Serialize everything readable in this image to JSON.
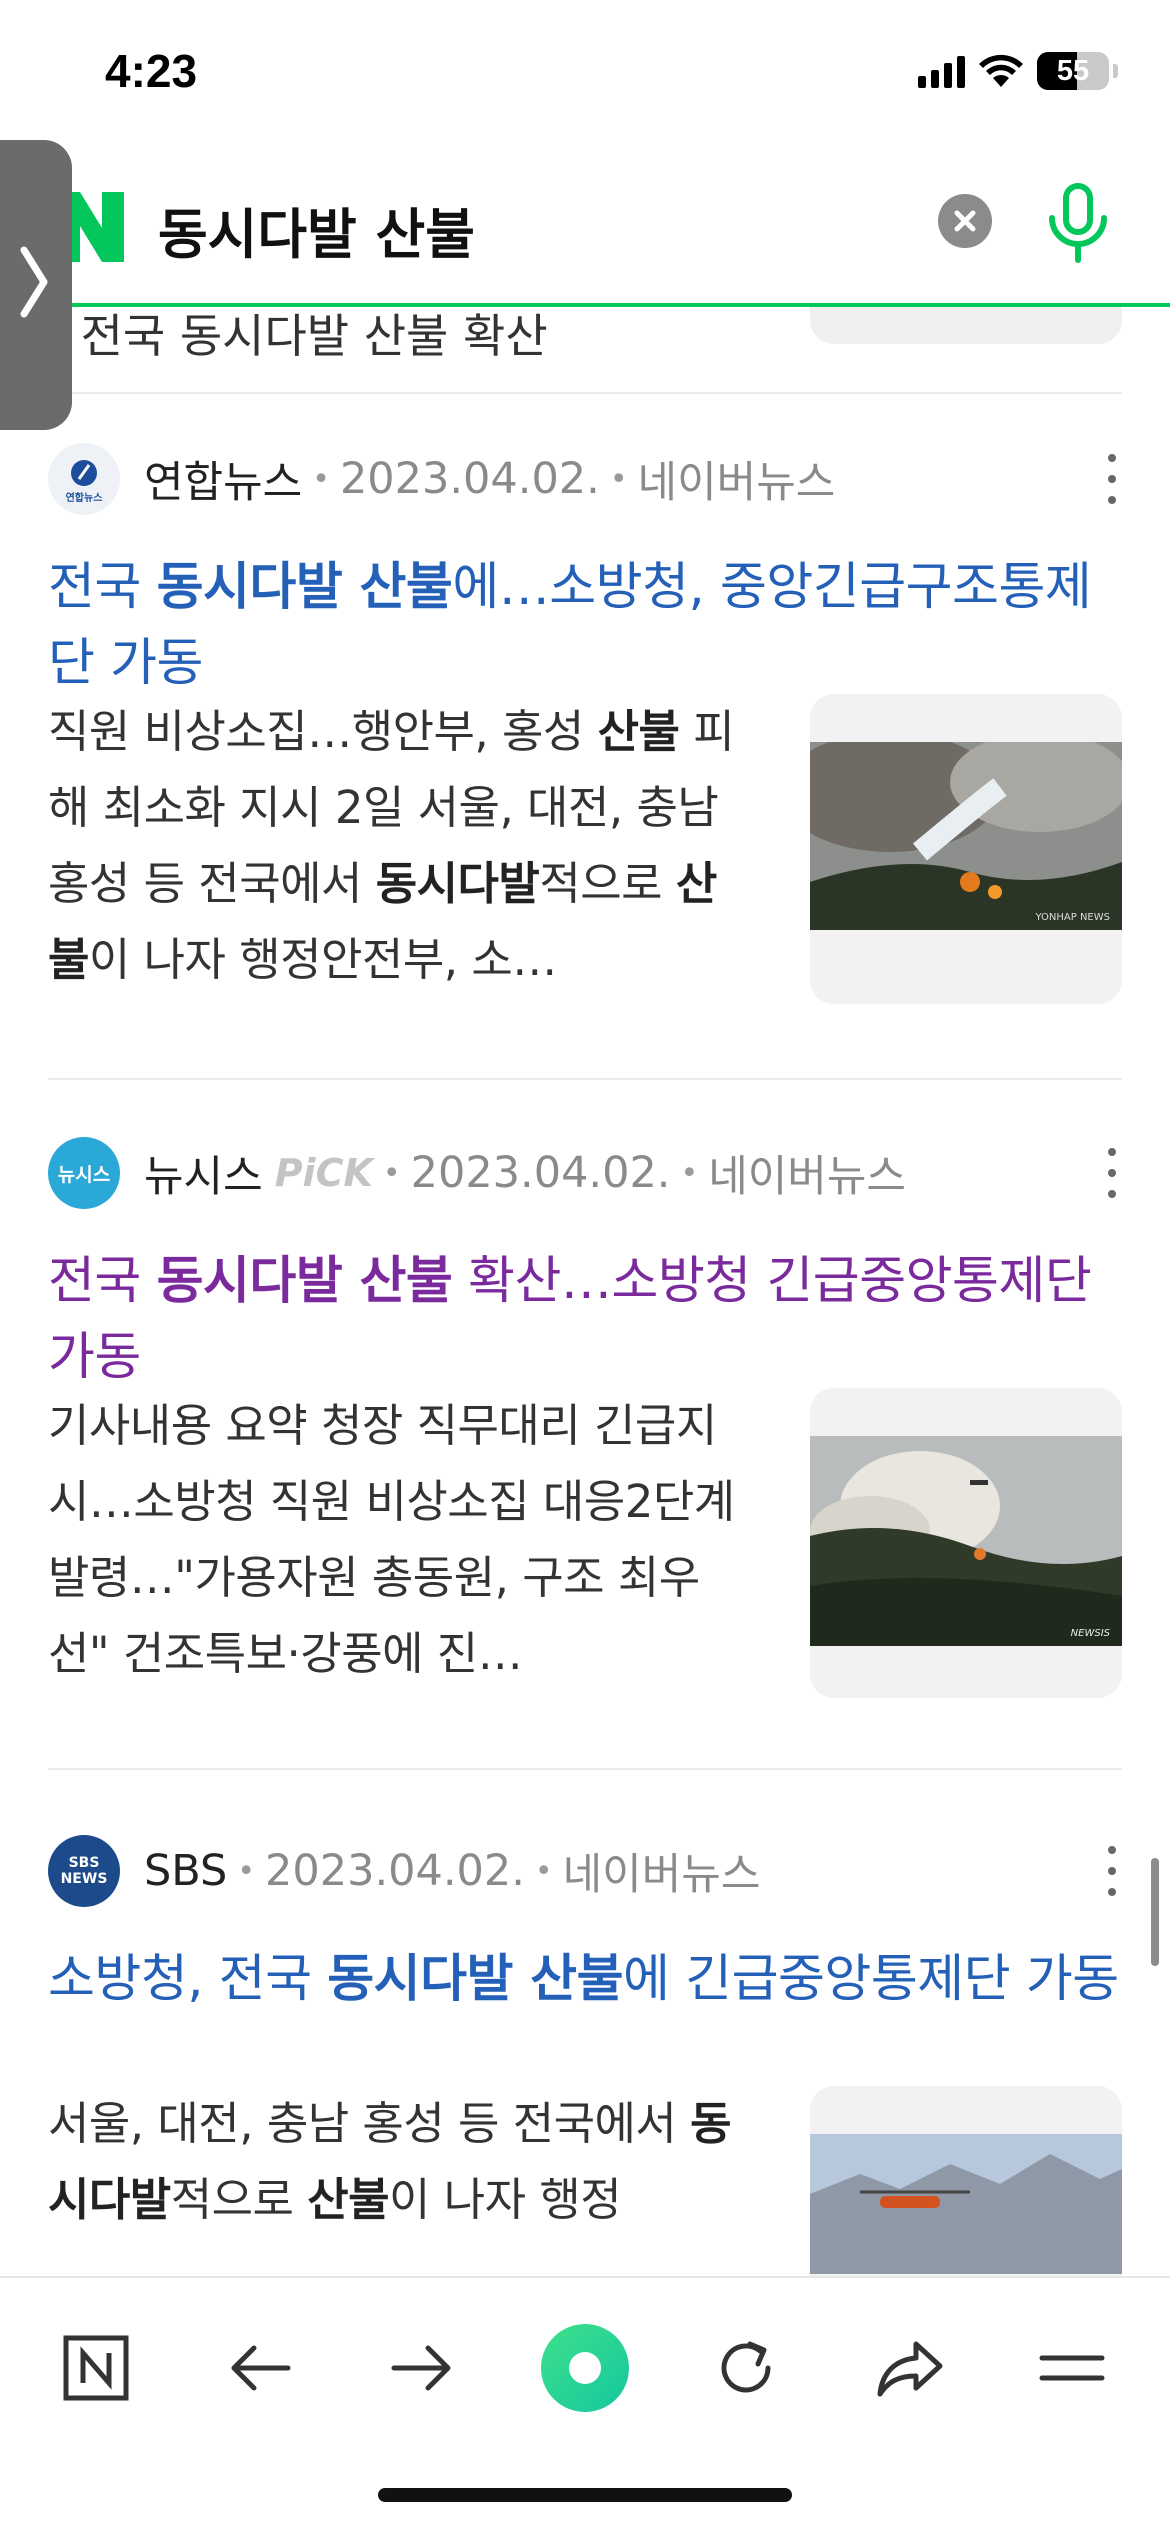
{
  "status_bar": {
    "time": "4:23",
    "battery_level": "55"
  },
  "search": {
    "query": "동시다발 산불"
  },
  "previous_item_fragment": "] 전국 동시다발 산불 확산",
  "news": [
    {
      "press": "연합뉴스",
      "press_logo_text": "연합뉴스",
      "pick": "",
      "date": "2023.04.02.",
      "portal": "네이버뉴스",
      "visited": false,
      "headline": [
        {
          "text": "전국 ",
          "bold": false
        },
        {
          "text": "동시다발 산불",
          "bold": true
        },
        {
          "text": "에…소방청, 중앙긴급구조통제단 가동",
          "bold": false
        }
      ],
      "snippet": [
        {
          "text": "직원 비상소집…행안부, 홍성 ",
          "bold": false
        },
        {
          "text": "산불",
          "bold": true
        },
        {
          "text": " 피해 최소화 지시 2일 서울, 대전, 충남 홍성 등 전국에서 ",
          "bold": false
        },
        {
          "text": "동시다발",
          "bold": true
        },
        {
          "text": "적으로 ",
          "bold": false
        },
        {
          "text": "산불",
          "bold": true
        },
        {
          "text": "이 나자 행정안전부, 소…",
          "bold": false
        }
      ],
      "image_watermark": "YONHAP NEWS"
    },
    {
      "press": "뉴시스",
      "press_logo_text": "뉴시스",
      "pick": "PiCK",
      "date": "2023.04.02.",
      "portal": "네이버뉴스",
      "visited": true,
      "headline": [
        {
          "text": "전국 ",
          "bold": false
        },
        {
          "text": "동시다발 산불",
          "bold": true
        },
        {
          "text": " 확산…소방청 긴급중앙통제단 가동",
          "bold": false
        }
      ],
      "snippet": [
        {
          "text": "기사내용 요약 청장 직무대리 긴급지시…소방청 직원 비상소집 대응2단계 발령…\"가용자원 총동원, 구조 최우선\" 건조특보·강풍에 진…",
          "bold": false
        }
      ],
      "image_watermark": "NEWSIS"
    },
    {
      "press": "SBS",
      "press_logo_text": "SBS NEWS",
      "pick": "",
      "date": "2023.04.02.",
      "portal": "네이버뉴스",
      "visited": false,
      "headline": [
        {
          "text": "소방청, 전국 ",
          "bold": false
        },
        {
          "text": "동시다발 산불",
          "bold": true
        },
        {
          "text": "에 긴급중앙통제단 가동",
          "bold": false
        }
      ],
      "snippet": [
        {
          "text": "서울, 대전, 충남 홍성 등 전국에서 ",
          "bold": false
        },
        {
          "text": "동시다발",
          "bold": true
        },
        {
          "text": "적으로 ",
          "bold": false
        },
        {
          "text": "산불",
          "bold": true
        },
        {
          "text": "이 나자 행정",
          "bold": false
        }
      ],
      "image_watermark": ""
    }
  ],
  "toolbar": {
    "items": [
      "naver-home",
      "back",
      "forward",
      "green-dot",
      "reload",
      "share",
      "menu"
    ]
  },
  "colors": {
    "naver_green": "#03c75a",
    "link_blue": "#2460b8",
    "visited_purple": "#7a2a9c"
  }
}
